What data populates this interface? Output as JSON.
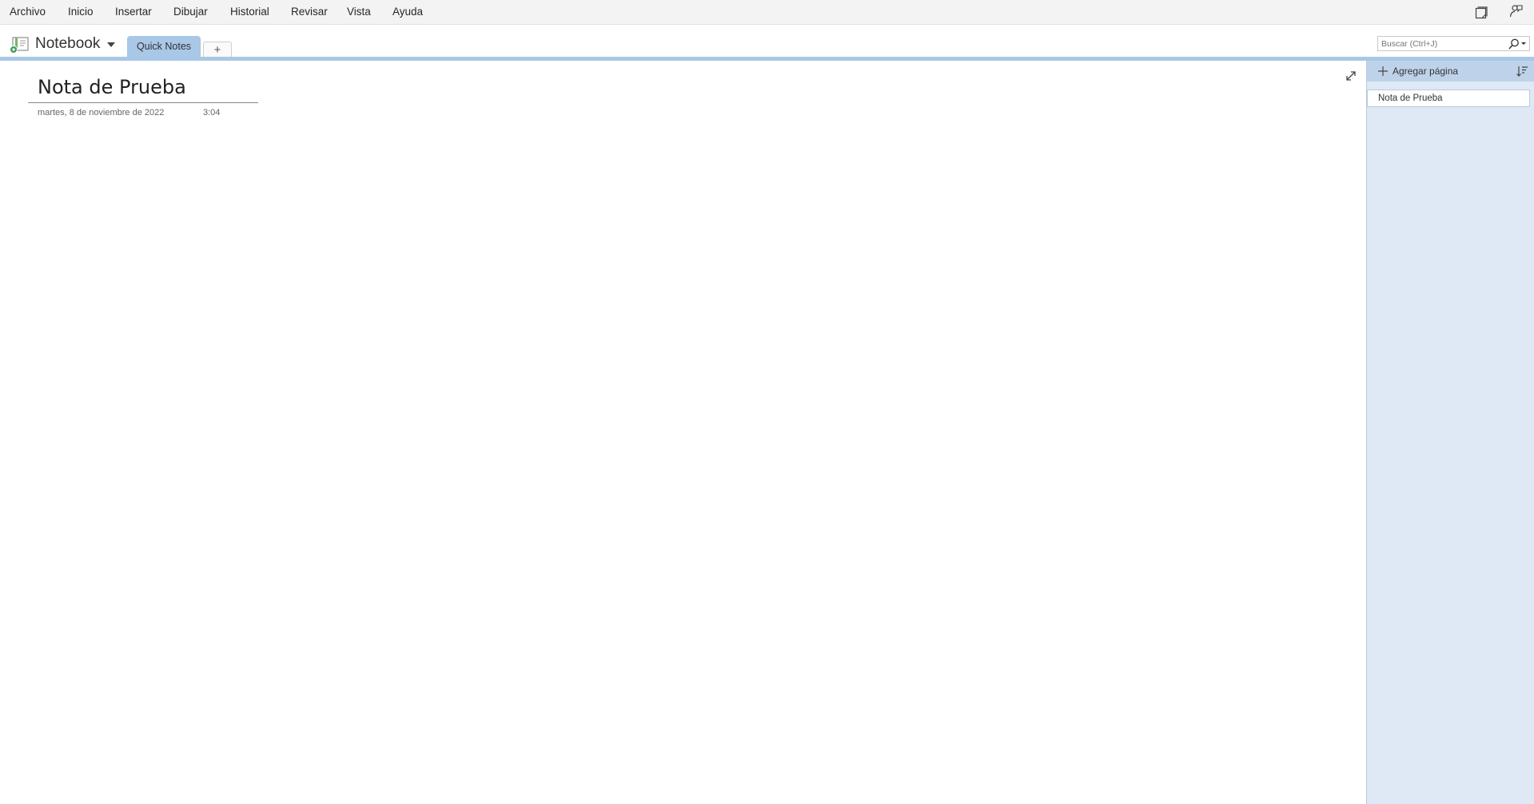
{
  "menu": {
    "items": [
      {
        "label": "Archivo"
      },
      {
        "label": "Inicio"
      },
      {
        "label": "Insertar"
      },
      {
        "label": "Dibujar"
      },
      {
        "label": "Historial"
      },
      {
        "label": "Revisar"
      },
      {
        "label": "Vista"
      },
      {
        "label": "Ayuda"
      }
    ],
    "right_icons": [
      "sticky-note-icon",
      "immersive-reader-icon"
    ]
  },
  "notebook": {
    "name": "Notebook",
    "section_tab": "Quick Notes",
    "add_section_label": "+"
  },
  "search": {
    "placeholder": "Buscar (Ctrl+J)"
  },
  "page": {
    "title": "Nota de Prueba",
    "date": "martes, 8 de noviembre de 2022",
    "time": "3:04"
  },
  "page_pane": {
    "add_page_label": "Agregar página",
    "pages": [
      {
        "title": "Nota de Prueba"
      }
    ]
  },
  "colors": {
    "accent": "#a9c7e6",
    "pane_background": "#dfe9f5",
    "menu_background": "#f3f3f3"
  }
}
